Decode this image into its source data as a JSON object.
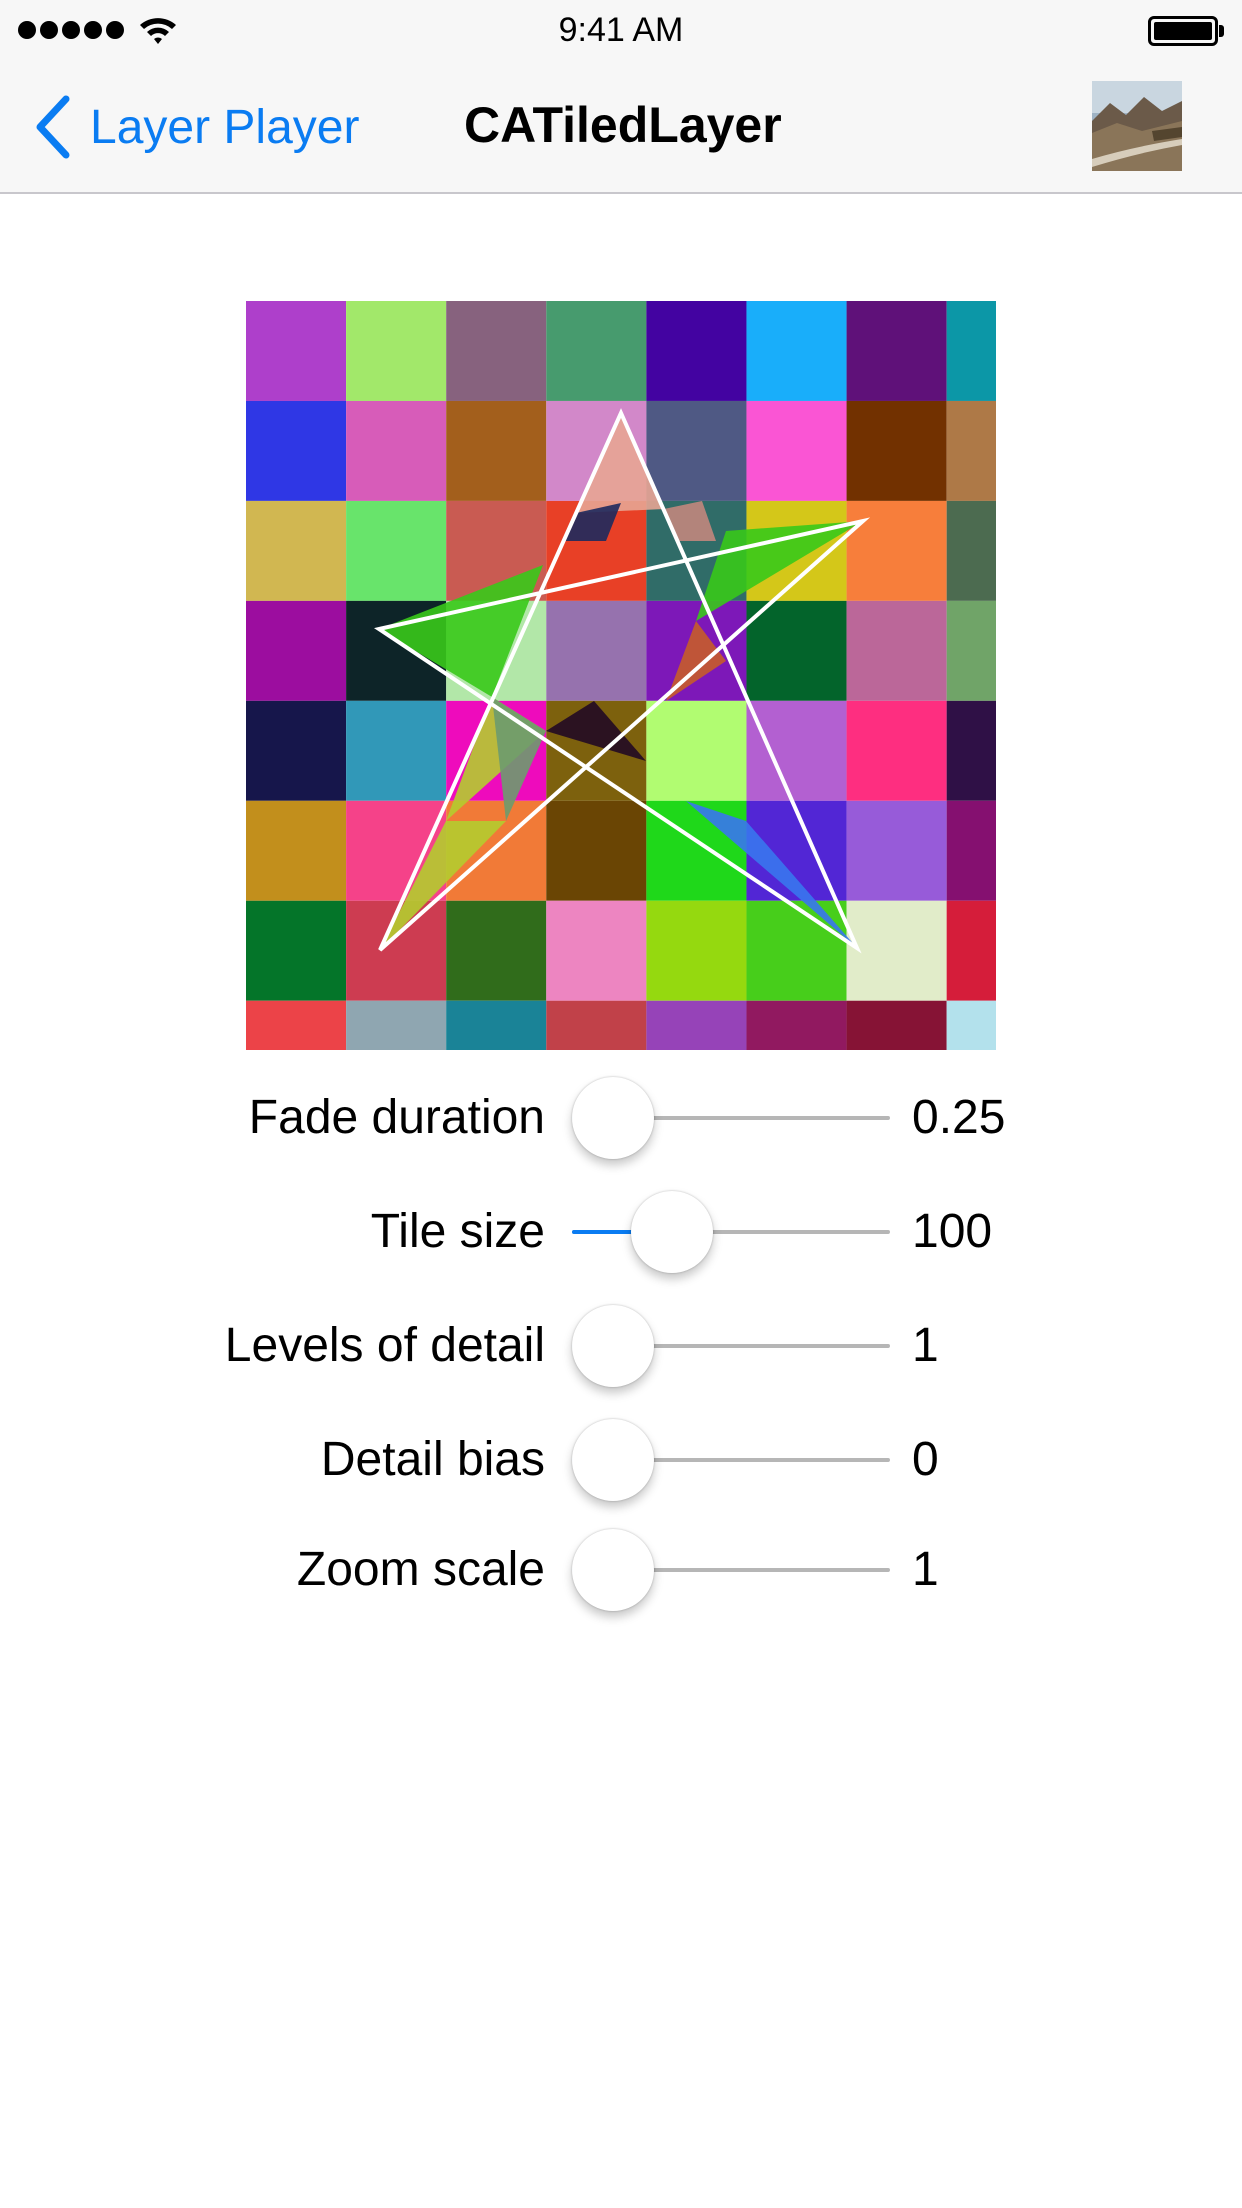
{
  "status_bar": {
    "time": "9:41 AM",
    "signal_icon": "signal-dots-icon",
    "wifi_icon": "wifi-icon",
    "battery_icon": "battery-icon"
  },
  "nav": {
    "back_label": "Layer Player",
    "back_icon": "chevron-left-icon",
    "title": "CATiledLayer",
    "thumbnail_icon": "landscape-photo-thumbnail",
    "tint_color": "#0a7cf2"
  },
  "tile_grid": {
    "rows": [
      [
        "#ae3fcb",
        "#a2e86a",
        "#87627e",
        "#479b6e",
        "#4303a1",
        "#19aefa",
        "#5f1179",
        "#0c97a7"
      ],
      [
        "#2f37e5",
        "#d75cb9",
        "#a35f1c",
        "#d288c9",
        "#4f5984",
        "#fa55d4",
        "#723100",
        "#ae7947"
      ],
      [
        "#d1b751",
        "#68e46b",
        "#c95b52",
        "#e84026",
        "#306c68",
        "#d4c719",
        "#f77e3b",
        "#4c6b50"
      ],
      [
        "#9c0d9f",
        "#0d2428",
        "#b2e7a8",
        "#9672ae",
        "#7d18b8",
        "#03642b",
        "#bb6799",
        "#70a468"
      ],
      [
        "#16164b",
        "#3198b8",
        "#ee0bbc",
        "#7d610d",
        "#b1fc71",
        "#b360d1",
        "#fe2e80",
        "#2f1046"
      ],
      [
        "#c28f1c",
        "#f54289",
        "#f17a37",
        "#6a4504",
        "#1fd81a",
        "#5226d5",
        "#975bd9",
        "#851070"
      ],
      [
        "#047529",
        "#cd3c51",
        "#306c1b",
        "#ed85c1",
        "#95d90f",
        "#47ce1b",
        "#e1ecc9",
        "#d51d3a"
      ],
      [
        "#ec4348",
        "#8fa6b1",
        "#1a8397",
        "#c14149",
        "#9643b8",
        "#911960",
        "#861335",
        "#b3e1ec"
      ]
    ],
    "star_fill_colors": {
      "top": "#e7a594",
      "upper_left": "#1d2a5e",
      "upper_right": "#c2877d",
      "left_arm": "#38c91a",
      "right_arm": "#c65c2a",
      "left_leg": "#b4cc2f",
      "right_leg": "#3877ee",
      "center_a": "#220a24",
      "center_b": "#6d9b6e"
    },
    "star_stroke": "#ffffff"
  },
  "controls": [
    {
      "label": "Fade duration",
      "value": "0.25",
      "level": 0.0
    },
    {
      "label": "Tile size",
      "value": "100",
      "level": 0.25
    },
    {
      "label": "Levels of detail",
      "value": "1",
      "level": 0.0
    },
    {
      "label": "Detail bias",
      "value": "0",
      "level": 0.0
    },
    {
      "label": "Zoom scale",
      "value": "1",
      "level": 0.0
    }
  ]
}
